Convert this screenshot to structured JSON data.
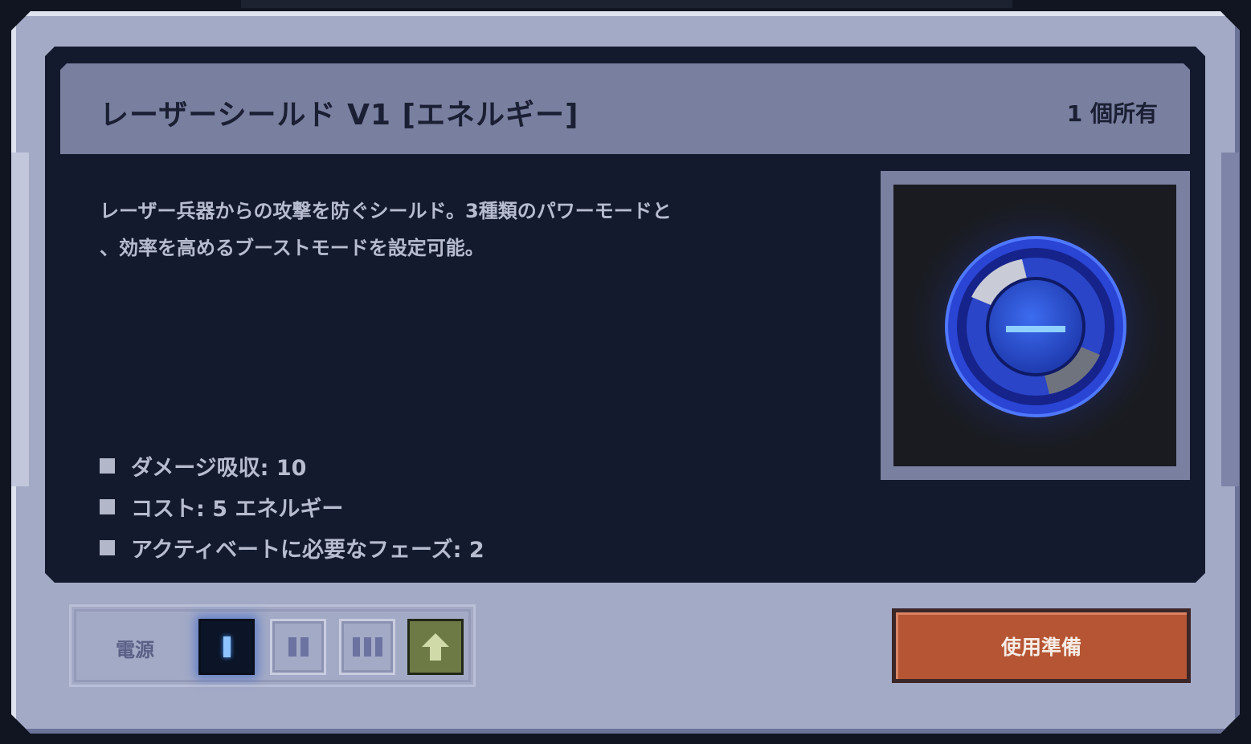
{
  "item": {
    "title": "レーザーシールド V1 [エネルギー]",
    "owned": "1 個所有",
    "description_line1": "レーザー兵器からの攻撃を防ぐシールド。3種類のパワーモードと",
    "description_line2": "、効率を高めるブーストモードを設定可能。",
    "stats": [
      "ダメージ吸収: 10",
      "コスト: 5 エネルギー",
      "アクティベートに必要なフェーズ: 2"
    ],
    "icon": "laser-shield-icon"
  },
  "power": {
    "label": "電源",
    "modes": [
      "I",
      "II",
      "III",
      "boost"
    ],
    "selected": "I"
  },
  "actions": {
    "ready_label": "使用準備"
  },
  "colors": {
    "panel": "#141a2e",
    "frame": "#a3aac6",
    "title_bar": "#797f9f",
    "ready_button": "#b65533",
    "boost_button": "#6d7a45",
    "shield_blue": "#2b4fd8"
  }
}
